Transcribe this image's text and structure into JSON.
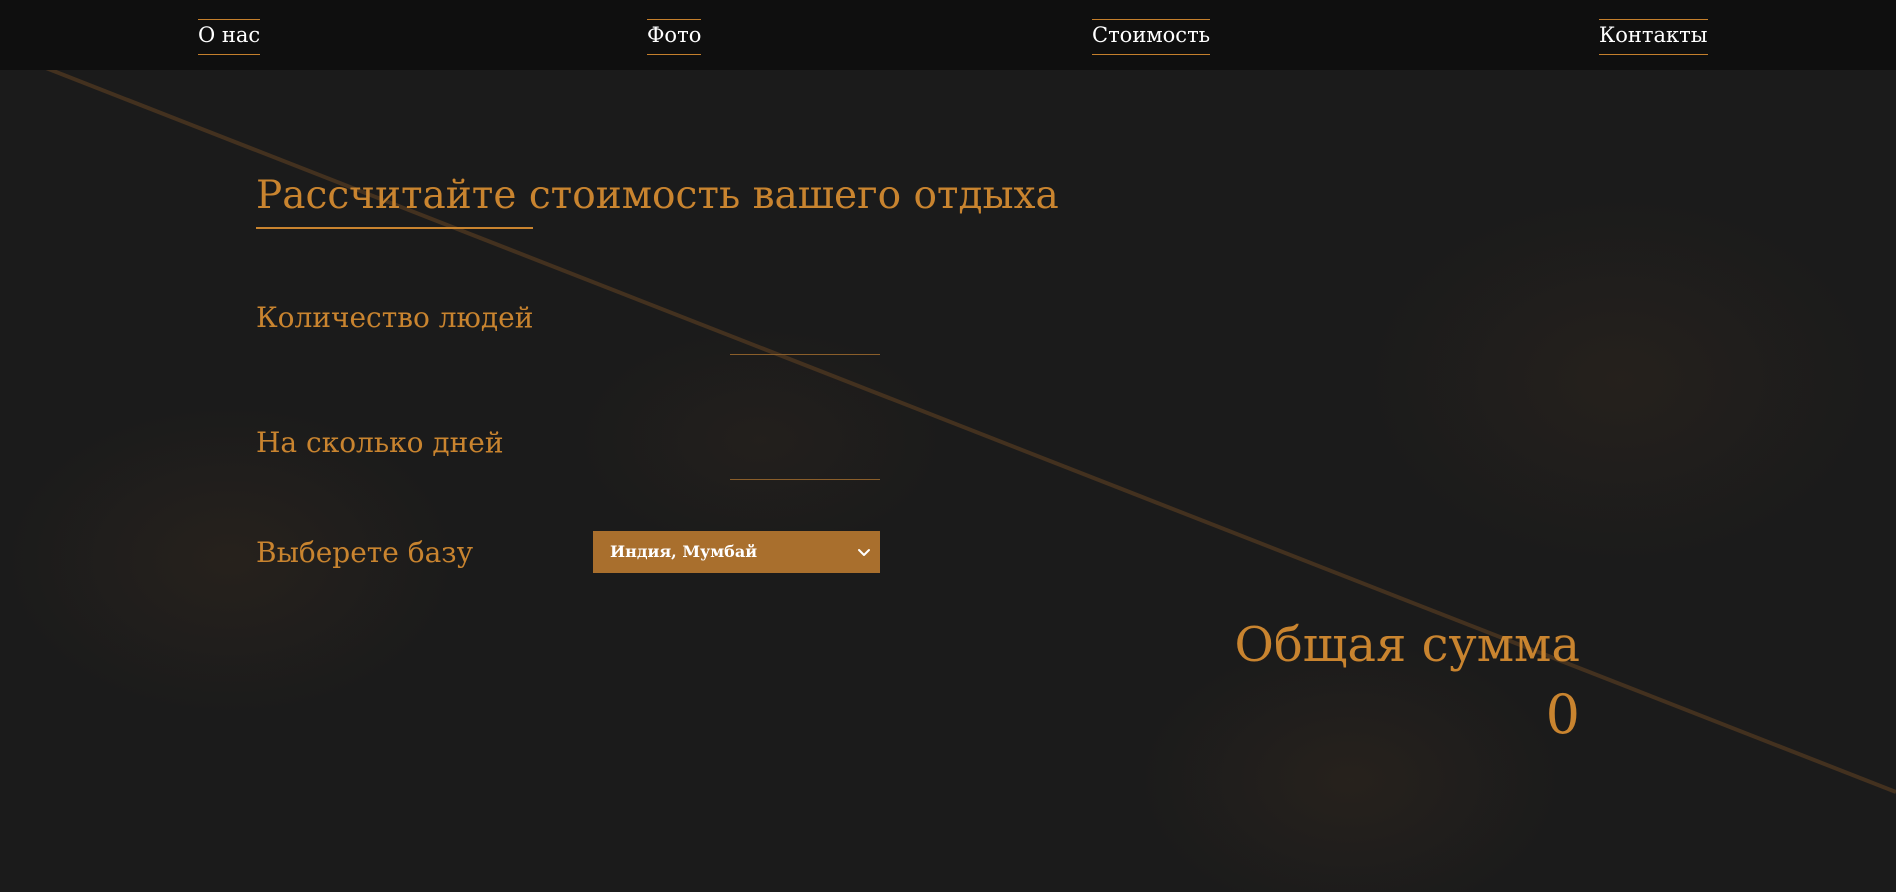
{
  "nav": {
    "items": [
      {
        "label": "О нас"
      },
      {
        "label": "Фото"
      },
      {
        "label": "Стоимость"
      },
      {
        "label": "Контакты"
      }
    ]
  },
  "calculator": {
    "title": "Рассчитайте стоимость вашего отдыха",
    "people_label": "Количество людей",
    "people_value": "",
    "days_label": "На сколько дней",
    "days_value": "",
    "base_label": "Выберете базу",
    "base_selected": "Индия, Мумбай",
    "total_label": "Общая сумма",
    "total_value": "0"
  },
  "colors": {
    "accent": "#c9842f",
    "select_bg": "#a96f2d",
    "background": "#1b1b1b",
    "nav_bg": "#0f0f0f"
  }
}
